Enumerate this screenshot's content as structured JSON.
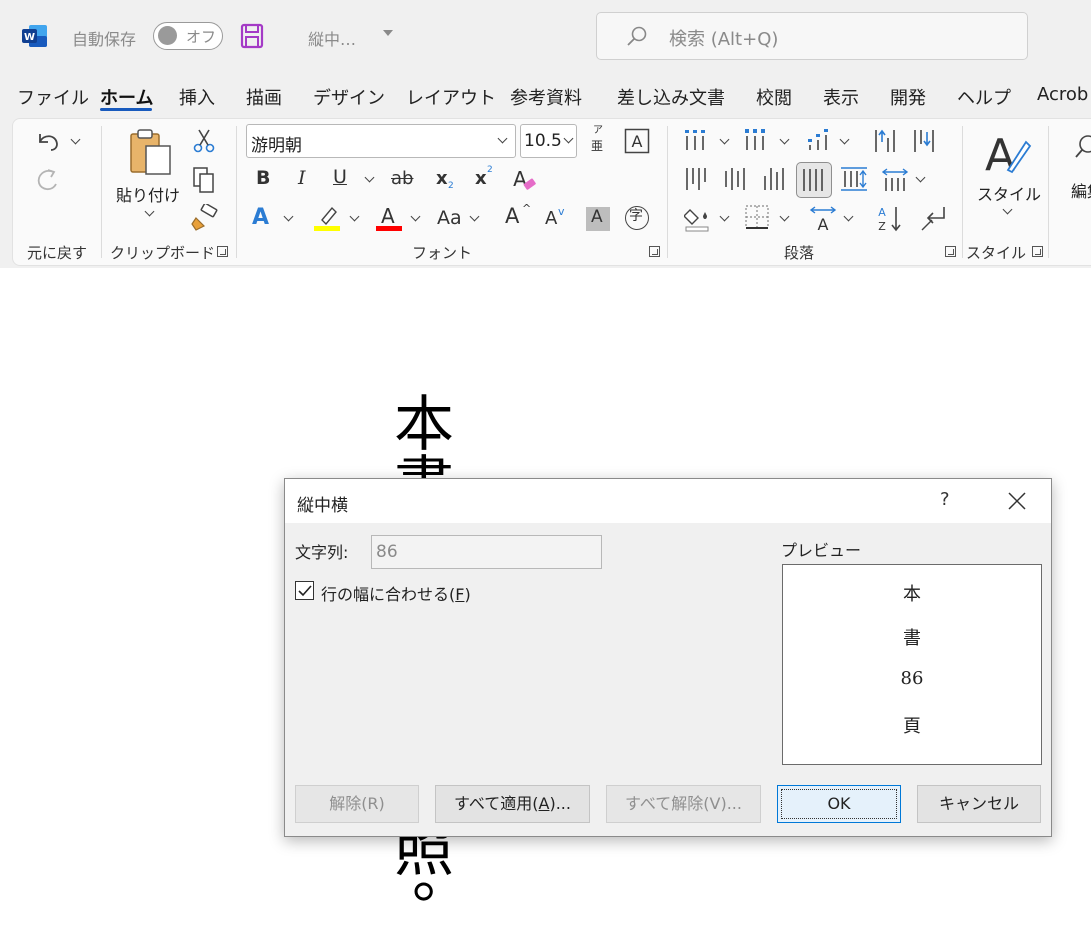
{
  "titlebar": {
    "autosave_label": "自動保存",
    "toggle_state": "オフ",
    "doc_title": "縦中…",
    "search_placeholder": "検索 (Alt+Q)"
  },
  "menu": {
    "items": [
      "ファイル",
      "ホーム",
      "挿入",
      "描画",
      "デザイン",
      "レイアウト",
      "参考資料",
      "差し込み文書",
      "校閲",
      "表示",
      "開発",
      "ヘルプ",
      "Acrob"
    ],
    "active": "ホーム"
  },
  "ribbon": {
    "groups": {
      "undo": "元に戻す",
      "clipboard": "クリップボード",
      "font": "フォント",
      "paragraph": "段落",
      "styles": "スタイル"
    },
    "paste_label": "貼り付け",
    "font_name": "游明朝",
    "font_size": "10.5",
    "styles_label": "スタイル",
    "edit_label": "編集",
    "ruby_top": "ア",
    "ruby_bottom": "亜",
    "bold": "B",
    "italic": "I",
    "underline": "U",
    "strike": "ab",
    "subscript": "x",
    "superscript": "x",
    "sub_mark": "2",
    "sup_mark": "2",
    "text_effect": "A",
    "font_color": "A",
    "change_case": "Aa",
    "grow": "A",
    "shrink": "A",
    "shading": "A",
    "enclose": "字",
    "colors": {
      "highlight": "#ffff00",
      "font_color": "#ff0000",
      "accent": "#185abd",
      "text_effect": "#2b7cd3"
    }
  },
  "document": {
    "chars_visible_top": [
      "本",
      "書"
    ],
    "chars_visible_bottom": [
      "照",
      "。"
    ]
  },
  "dialog": {
    "title": "縦中横",
    "help": "?",
    "text_label": "文字列:",
    "text_value": "86",
    "fit_line_label_pre": "行の幅に合わせる(",
    "fit_line_key": "F",
    "fit_line_label_post": ")",
    "fit_line_checked": true,
    "preview_label": "プレビュー",
    "preview_chars": [
      "本",
      "書",
      "86",
      "頁"
    ],
    "buttons": {
      "remove": "解除(R)",
      "apply_all_pre": "すべて適用(",
      "apply_all_key": "A",
      "apply_all_post": ")...",
      "remove_all": "すべて解除(V)...",
      "ok": "OK",
      "cancel": "キャンセル"
    }
  }
}
